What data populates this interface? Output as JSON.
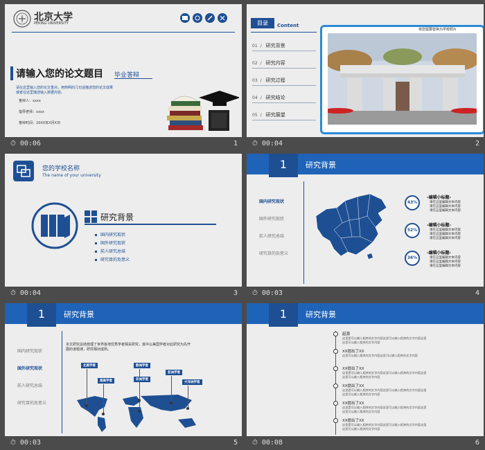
{
  "slides": [
    {
      "logo_cn": "北京大学",
      "logo_en": "PEKING UNIVERSITY",
      "title": "请输入您的论文题目",
      "subtitle": "毕业答辩",
      "desc1": "请在这里输入您的论文重点，用简明的几句话描述您的论文成果",
      "desc2": "或者在这里描述输入数据内容。",
      "f1_label": "答辩人：",
      "f1_value": "xxxx",
      "f2_label": "指导老师：",
      "f2_value": "xxxx",
      "f3_label": "答辩时间：",
      "f3_value": "20XX年X月X日",
      "time": "00:06",
      "num": "1"
    },
    {
      "tag": "目录",
      "tag_en": "Content",
      "items": [
        {
          "no": "01",
          "label": "研究背景"
        },
        {
          "no": "02",
          "label": "研究内容"
        },
        {
          "no": "03",
          "label": "研究过程"
        },
        {
          "no": "04",
          "label": "研究结论"
        },
        {
          "no": "05",
          "label": "研究展望"
        }
      ],
      "caption": "将您需要替换为学校照片",
      "time": "00:04",
      "num": "2"
    },
    {
      "school": "您的学校名称",
      "school_en": "The name of your university",
      "heading": "研究背景",
      "bullets": [
        "国内研究现状",
        "国外研究现状",
        "前人研究总结",
        "研究目的及意义"
      ],
      "time": "00:04",
      "num": "3"
    },
    {
      "bar_no": "1",
      "bar_title": "研究背景",
      "menu": [
        "国内研究现状",
        "国外研究现状",
        "前人研究总结",
        "研究目的及意义"
      ],
      "stats": [
        {
          "pct": "43%",
          "title": "-编辑小标题-",
          "lines": [
            "请在这里编辑文本内容",
            "请在这里编辑文本内容",
            "请在这里编辑文本内容"
          ]
        },
        {
          "pct": "52%",
          "title": "-编辑小标题-",
          "lines": [
            "请在这里编辑文本内容",
            "请在这里编辑文本内容",
            "请在这里编辑文本内容"
          ]
        },
        {
          "pct": "36%",
          "title": "-编辑小标题-",
          "lines": [
            "请在这里编辑文本内容",
            "请在这里编辑文本内容",
            "请在这里编辑文本内容"
          ]
        }
      ],
      "time": "00:03",
      "num": "4"
    },
    {
      "bar_no": "1",
      "bar_title": "研究背景",
      "menu": [
        "国内研究现状",
        "国外研究现状",
        "前人研究总结",
        "研究目的及意义"
      ],
      "para1": "本文研究总结梳理了世界各地优秀学者相关研究，其中以美国学者对此研究为先开",
      "para2": "展的该题课，研究相对成熟。",
      "labels": [
        "北美学者",
        "南美学者",
        "欧洲学者",
        "非洲学者",
        "亚洲学者",
        "大洋洲学者"
      ],
      "time": "00:03",
      "num": "5"
    },
    {
      "bar_no": "1",
      "bar_title": "研究背景",
      "timeline": [
        {
          "title": "起源",
          "lines": [
            "这里是可以输入相关的文字内容这里可以输入相关的文字内容这里",
            "这里可以输入相关的文字内容"
          ]
        },
        {
          "title": "XX提出了XX",
          "lines": [
            "这里可以输入相关的文字内容这里可以输入相关的文字内容"
          ]
        },
        {
          "title": "XX提出了XX",
          "lines": [
            "这里是可以输入相关的文字内容这里可以输入相关的文字内容这里",
            "这里可以输入相关的文字内容"
          ]
        },
        {
          "title": "XX提出了XX",
          "lines": [
            "这里是可以输入相关的文字内容这里可以输入相关的文字内容这里",
            "这里可以输入相关的文字内容"
          ]
        },
        {
          "title": "XX提出了XX",
          "lines": [
            "这里是可以输入相关的文字内容这里可以输入相关的文字内容这里",
            "这里可以输入相关的文字内容"
          ]
        },
        {
          "title": "XX提出了XX",
          "lines": [
            "这里是可以输入相关的文字内容这里可以输入相关的文字内容这里",
            "这里可以输入相关的文字内容"
          ]
        }
      ],
      "time": "00:08",
      "num": "6"
    }
  ]
}
